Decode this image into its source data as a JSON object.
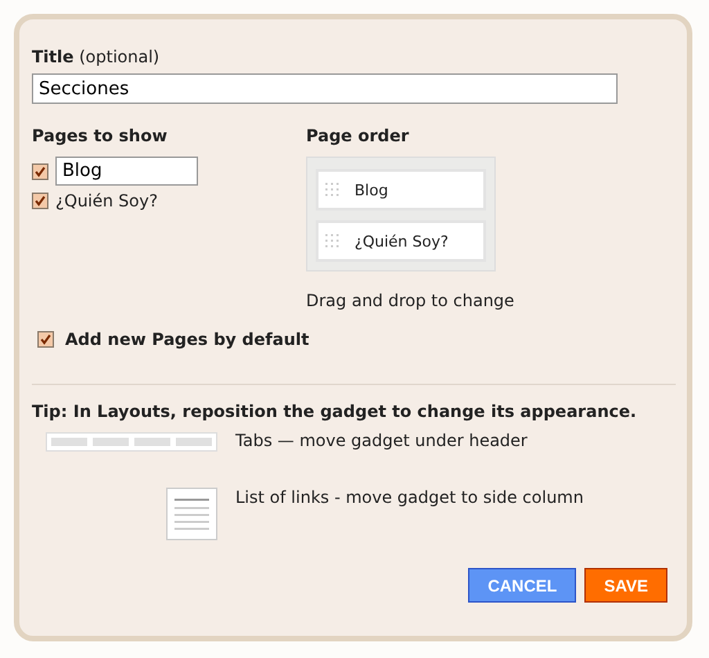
{
  "title_field": {
    "label": "**Title** (optional)",
    "value": "Secciones"
  },
  "pages_to_show": {
    "heading": "Pages to show",
    "items": [
      {
        "kind": "field",
        "label": "Blog",
        "checked": true
      },
      {
        "kind": "text",
        "label": "¿Quién Soy?",
        "checked": true
      }
    ]
  },
  "page_order": {
    "heading": "Page order",
    "items": [
      "Blog",
      "¿Quién Soy?"
    ],
    "hint": "Drag and drop to change"
  },
  "add_new_pages": {
    "label": "Add new Pages by default",
    "checked": true
  },
  "tip": {
    "text": "Tip: In Layouts, reposition the gadget to change its appearance.",
    "options": [
      {
        "kind": "tabs",
        "label": "Tabs — move gadget under header"
      },
      {
        "kind": "list",
        "label": "List of links - move gadget to side column"
      }
    ]
  },
  "buttons": [
    {
      "kind": "cancel",
      "label": "CANCEL"
    },
    {
      "kind": "save",
      "label": "SAVE"
    }
  ]
}
